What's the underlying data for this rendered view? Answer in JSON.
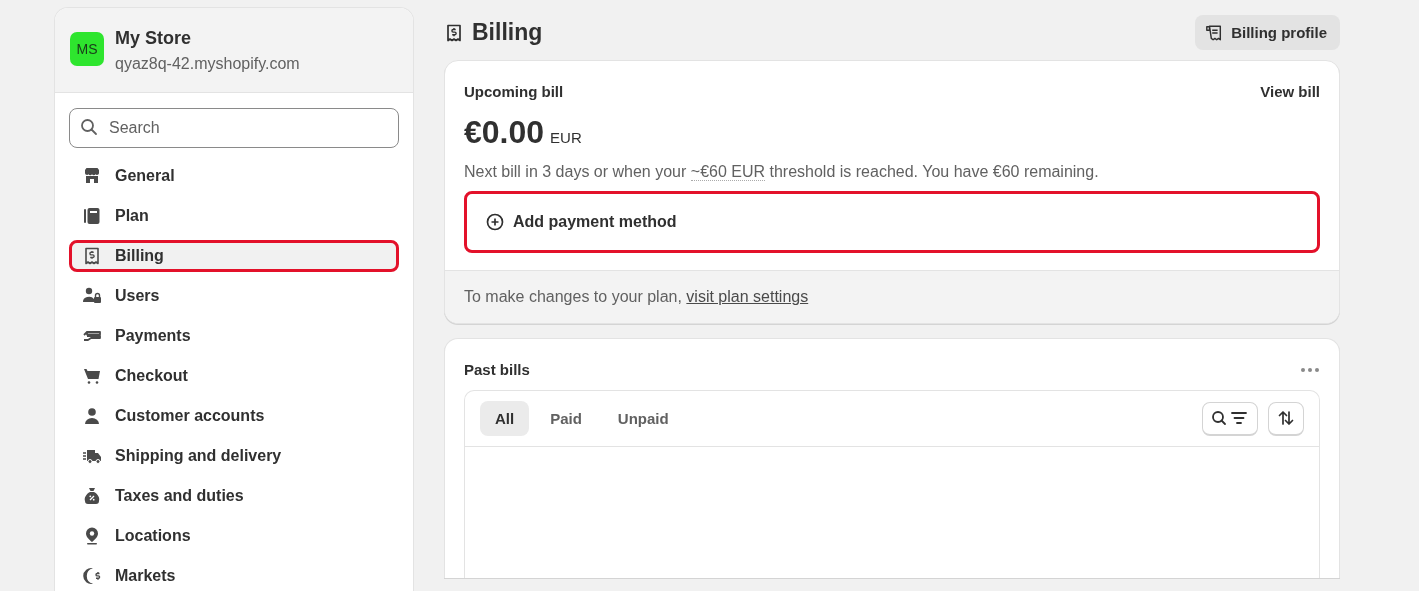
{
  "store": {
    "initials": "MS",
    "name": "My Store",
    "domain": "qyaz8q-42.myshopify.com",
    "color": "#2ee52e"
  },
  "search": {
    "placeholder": "Search"
  },
  "nav": [
    {
      "label": "General",
      "selected": false,
      "highlighted": false
    },
    {
      "label": "Plan",
      "selected": false,
      "highlighted": false
    },
    {
      "label": "Billing",
      "selected": true,
      "highlighted": true
    },
    {
      "label": "Users",
      "selected": false,
      "highlighted": false
    },
    {
      "label": "Payments",
      "selected": false,
      "highlighted": false
    },
    {
      "label": "Checkout",
      "selected": false,
      "highlighted": false
    },
    {
      "label": "Customer accounts",
      "selected": false,
      "highlighted": false
    },
    {
      "label": "Shipping and delivery",
      "selected": false,
      "highlighted": false
    },
    {
      "label": "Taxes and duties",
      "selected": false,
      "highlighted": false
    },
    {
      "label": "Locations",
      "selected": false,
      "highlighted": false
    },
    {
      "label": "Markets",
      "selected": false,
      "highlighted": false
    }
  ],
  "page": {
    "title": "Billing",
    "action": "Billing profile"
  },
  "upcoming": {
    "title": "Upcoming bill",
    "link": "View bill",
    "amount": "€0.00",
    "currency": "EUR",
    "note_before": "Next bill in 3 days or when your ",
    "note_threshold": "~€60 EUR",
    "note_after": " threshold is reached. You have €60 remaining.",
    "add_payment": {
      "label": "Add payment method",
      "highlighted": true
    },
    "footer_text": "To make changes to your plan, ",
    "footer_link": "visit plan settings"
  },
  "past_bills": {
    "title": "Past bills",
    "tabs": [
      {
        "label": "All",
        "selected": true
      },
      {
        "label": "Paid",
        "selected": false
      },
      {
        "label": "Unpaid",
        "selected": false
      }
    ]
  }
}
